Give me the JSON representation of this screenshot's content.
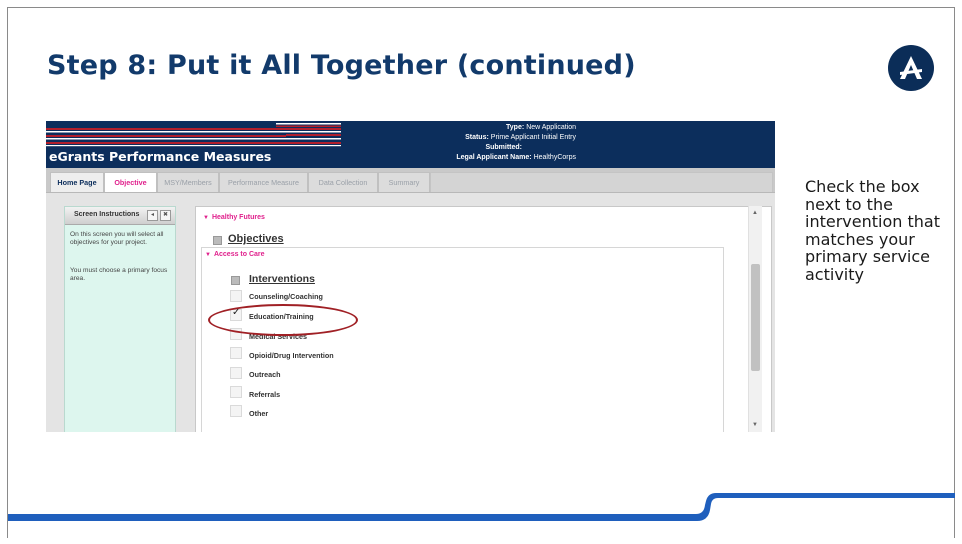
{
  "slide": {
    "title": "Step 8:  Put it All Together (continued)",
    "side_note": "Check the box next to the intervention that matches your primary service activity",
    "logo_icon": "americorps-logo-icon",
    "colors": {
      "title": "#123a6b",
      "header_bg": "#0c2e5c",
      "accent_pink": "#e0208c",
      "bottom_band": "#1f5fbd",
      "highlight_oval": "#a02025"
    }
  },
  "app": {
    "title": "eGrants Performance Measures",
    "type_label": "Type:",
    "type_value": "New Application",
    "status_label": "Status:",
    "status_value": "Prime Applicant Initial Entry",
    "submitted_label": "Submitted:",
    "submitted_value": "",
    "legal_label": "Legal Applicant Name:",
    "legal_value": "HealthyCorps",
    "tabs": [
      {
        "label": "Home Page",
        "state": "home"
      },
      {
        "label": "Objective",
        "state": "active"
      },
      {
        "label": "MSY/Members",
        "state": "disabled"
      },
      {
        "label": "Performance Measure",
        "state": "disabled"
      },
      {
        "label": "Data Collection",
        "state": "disabled"
      },
      {
        "label": "Summary",
        "state": "disabled"
      }
    ],
    "instructions": {
      "title": "Screen Instructions",
      "text1": "On this screen you will select all objectives for your project.",
      "text2": "You must choose a primary focus area."
    },
    "focus_area": "Healthy Futures",
    "objectives_heading": "Objectives",
    "objective": "Access to Care",
    "interventions_heading": "Interventions",
    "interventions": [
      {
        "label": "Counseling/Coaching",
        "checked": false
      },
      {
        "label": "Education/Training",
        "checked": true
      },
      {
        "label": "Medical Services",
        "checked": false
      },
      {
        "label": "Opioid/Drug Intervention",
        "checked": false
      },
      {
        "label": "Outreach",
        "checked": false
      },
      {
        "label": "Referrals",
        "checked": false
      },
      {
        "label": "Other",
        "checked": false
      }
    ]
  }
}
